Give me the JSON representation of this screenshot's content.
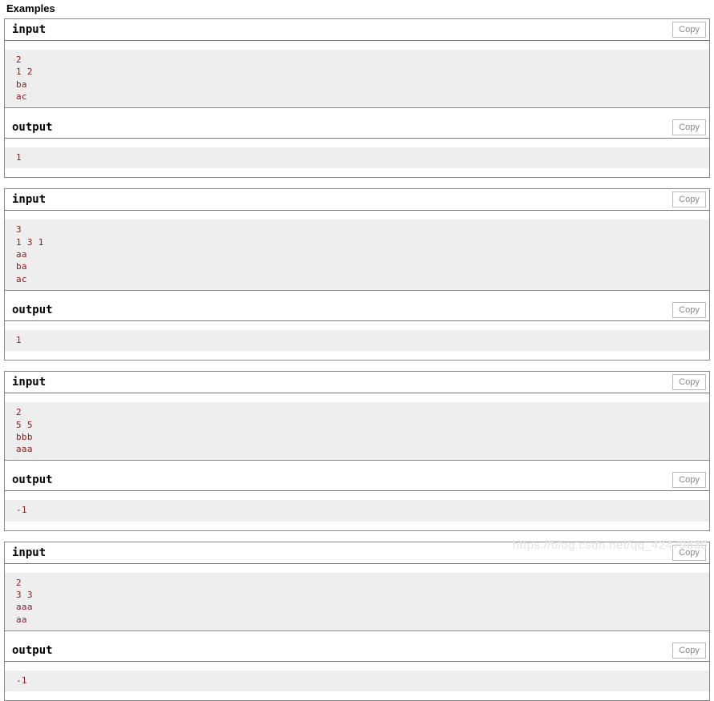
{
  "section": {
    "title": "Examples"
  },
  "labels": {
    "input_title": "input",
    "output_title": "output",
    "copy_label": "Copy"
  },
  "colors": {
    "code_text": "#8b1a1a",
    "content_background": "#eeeeee",
    "header_background": "#ffffff",
    "border": "#888888",
    "copy_button_text": "#888888",
    "copy_button_border": "#bbbbbb",
    "watermark": "#e4e4e4"
  },
  "samples": [
    {
      "input": "2\n1 2\nba\nac",
      "output": "1"
    },
    {
      "input": "3\n1 3 1\naa\nba\nac",
      "output": "1"
    },
    {
      "input": "2\n5 5\nbbb\naaa",
      "output": "-1"
    },
    {
      "input": "2\n3 3\naaa\naa",
      "output": "-1"
    }
  ],
  "watermark": {
    "text": "https://blog.csdn.net/qq_42479630"
  }
}
